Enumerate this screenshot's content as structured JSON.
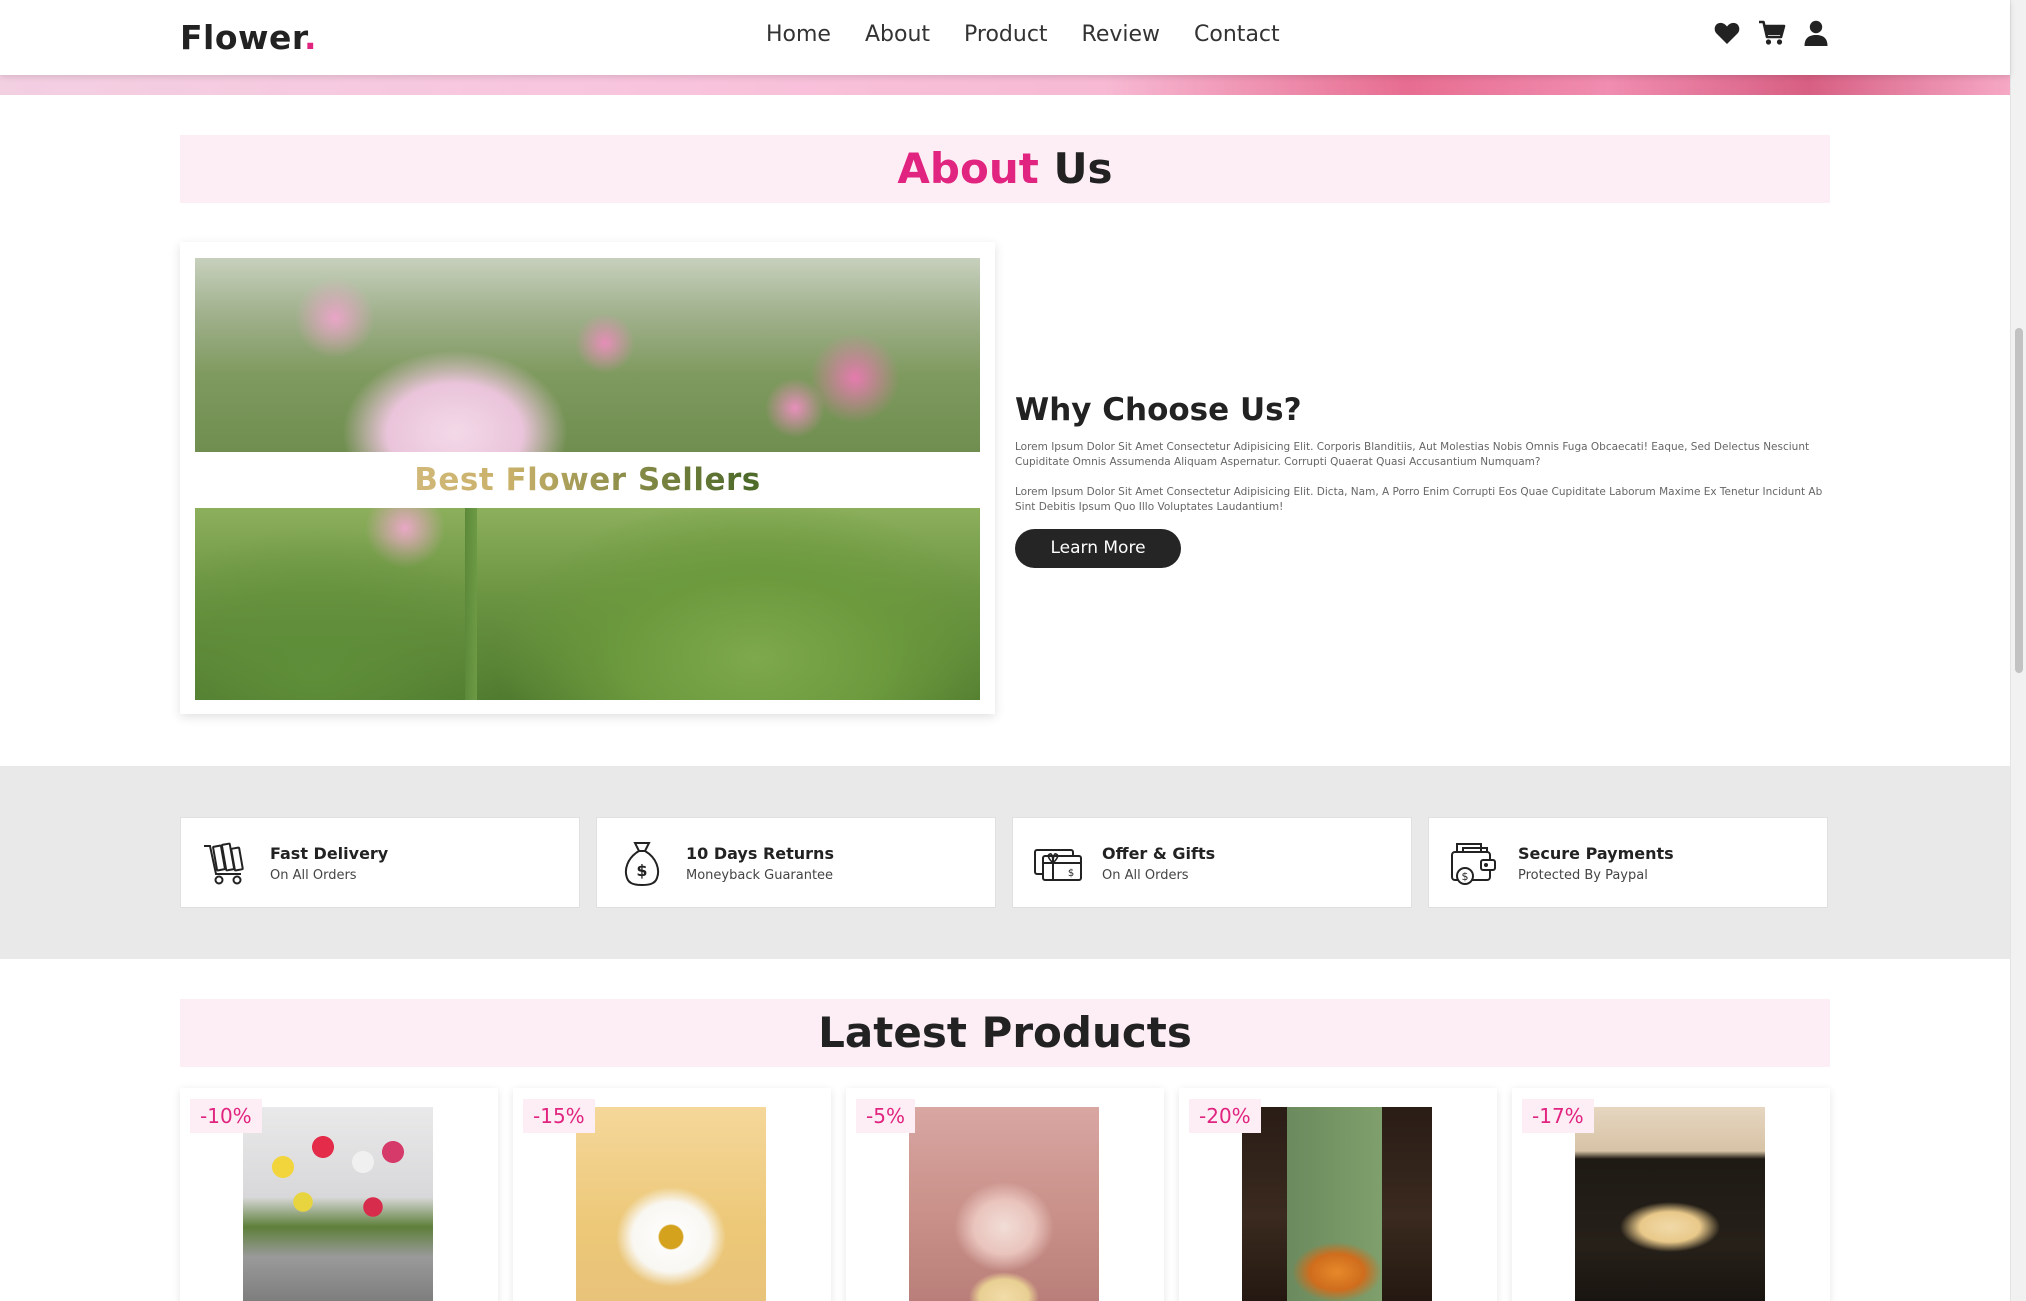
{
  "header": {
    "logo_text": "Flower",
    "logo_dot": ".",
    "nav": [
      "Home",
      "About",
      "Product",
      "Review",
      "Contact"
    ],
    "icons": [
      "heart-icon",
      "cart-icon",
      "user-icon"
    ]
  },
  "about": {
    "title_accent": "About",
    "title_rest": "Us",
    "image_caption": "Best Flower Sellers",
    "heading": "Why Choose Us?",
    "paragraph1": "Lorem Ipsum Dolor Sit Amet Consectetur Adipisicing Elit. Corporis Blanditiis, Aut Molestias Nobis Omnis Fuga Obcaecati! Eaque, Sed Delectus Nesciunt Cupiditate Omnis Assumenda Aliquam Aspernatur. Corrupti Quaerat Quasi Accusantium Numquam?",
    "paragraph2": "Lorem Ipsum Dolor Sit Amet Consectetur Adipisicing Elit. Dicta, Nam, A Porro Enim Corrupti Eos Quae Cupiditate Laborum Maxime Ex Tenetur Incidunt Ab Sint Debitis Ipsum Quo Illo Voluptates Laudantium!",
    "button": "Learn More"
  },
  "features": [
    {
      "icon": "delivery-cart-icon",
      "title": "Fast Delivery",
      "subtitle": "On All Orders"
    },
    {
      "icon": "money-bag-icon",
      "title": "10 Days Returns",
      "subtitle": "Moneyback Guarantee"
    },
    {
      "icon": "gift-card-icon",
      "title": "Offer & Gifts",
      "subtitle": "On All Orders"
    },
    {
      "icon": "secure-wallet-icon",
      "title": "Secure Payments",
      "subtitle": "Protected By Paypal"
    }
  ],
  "products": {
    "title": "Latest Products",
    "items": [
      {
        "discount": "-10%"
      },
      {
        "discount": "-15%"
      },
      {
        "discount": "-5%"
      },
      {
        "discount": "-20%"
      },
      {
        "discount": "-17%"
      }
    ]
  },
  "colors": {
    "accent": "#e0247f",
    "title_band": "#fdeef5",
    "button_bg": "#252525",
    "features_bg": "#e9e9e9"
  }
}
